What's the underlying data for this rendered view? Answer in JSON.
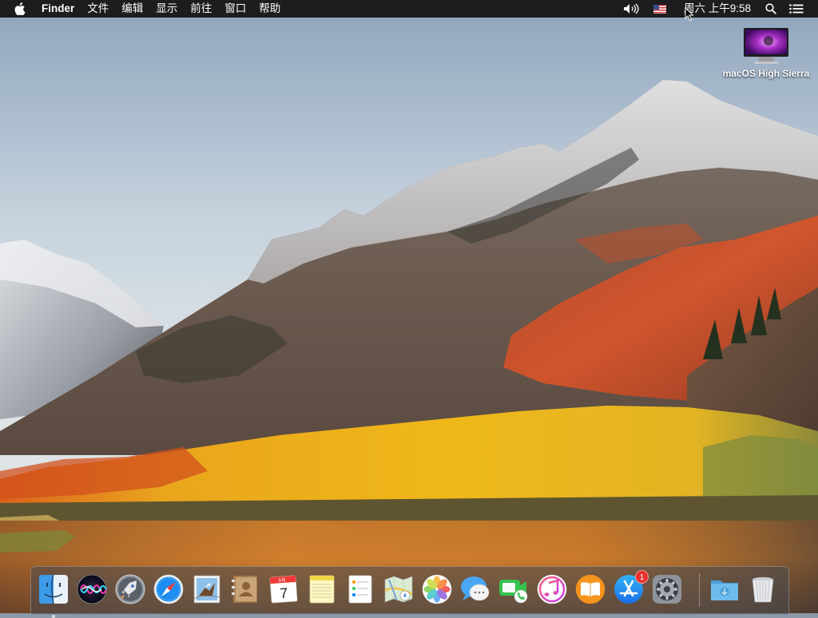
{
  "menubar": {
    "apple_icon": "apple-icon",
    "app_name": "Finder",
    "menus": [
      "文件",
      "编辑",
      "显示",
      "前往",
      "窗口",
      "帮助"
    ],
    "status": {
      "volume_icon": "volume-icon",
      "input_source_icon": "us-flag-icon",
      "clock": "周六 上午9:58",
      "spotlight_icon": "search-icon",
      "notification_icon": "list-icon"
    }
  },
  "desktop": {
    "icons": [
      {
        "label": "macOS High Sierra",
        "icon": "monitor-icon"
      }
    ]
  },
  "dock": {
    "apps": [
      {
        "name": "Finder",
        "icon": "finder-icon",
        "running": true
      },
      {
        "name": "Siri",
        "icon": "siri-icon"
      },
      {
        "name": "Launchpad",
        "icon": "rocket-icon"
      },
      {
        "name": "Safari",
        "icon": "compass-icon"
      },
      {
        "name": "Mail",
        "icon": "stamp-icon"
      },
      {
        "name": "Contacts",
        "icon": "address-book-icon"
      },
      {
        "name": "Calendar",
        "icon": "calendar-icon",
        "month": "9月",
        "day": "7"
      },
      {
        "name": "Notes",
        "icon": "notes-icon"
      },
      {
        "name": "Reminders",
        "icon": "reminders-icon"
      },
      {
        "name": "Maps",
        "icon": "map-icon"
      },
      {
        "name": "Photos",
        "icon": "photos-icon"
      },
      {
        "name": "Messages",
        "icon": "messages-icon"
      },
      {
        "name": "FaceTime",
        "icon": "facetime-icon"
      },
      {
        "name": "iTunes",
        "icon": "music-note-icon"
      },
      {
        "name": "iBooks",
        "icon": "book-icon"
      },
      {
        "name": "App Store",
        "icon": "app-store-icon",
        "badge": "1"
      },
      {
        "name": "System Preferences",
        "icon": "gear-icon"
      },
      {
        "name": "Downloads",
        "icon": "folder-download-icon"
      },
      {
        "name": "Trash",
        "icon": "trash-icon"
      }
    ]
  },
  "colors": {
    "menubar": "#1d1d1f",
    "badge": "#e8322d"
  }
}
